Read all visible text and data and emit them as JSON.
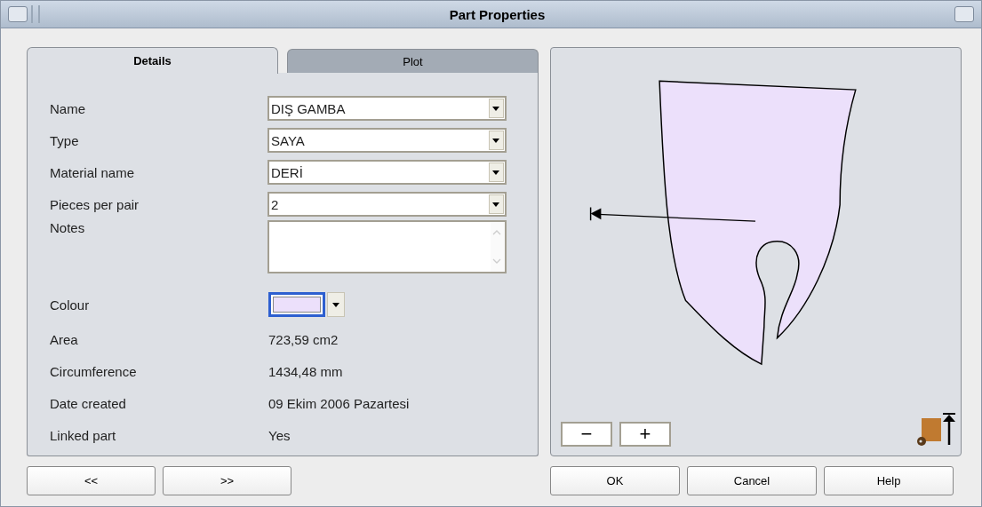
{
  "window": {
    "title": "Part Properties"
  },
  "tabs": [
    {
      "label": "Details",
      "selected": true
    },
    {
      "label": "Plot",
      "selected": false
    }
  ],
  "fields": [
    {
      "kind": "combo",
      "label": "Name",
      "value": "DIŞ GAMBA"
    },
    {
      "kind": "combo",
      "label": "Type",
      "value": "SAYA"
    },
    {
      "kind": "combo",
      "label": "Material name",
      "value": "DERİ"
    },
    {
      "kind": "combo",
      "label": "Pieces per pair",
      "value": "2"
    },
    {
      "kind": "memo",
      "label": "Notes"
    },
    {
      "kind": "colour",
      "label": "Colour",
      "color": "#ece0fb"
    },
    {
      "kind": "info",
      "label": "Area",
      "value": "723,59 cm2"
    },
    {
      "kind": "info",
      "label": "Circumference",
      "value": "1434,48 mm"
    },
    {
      "kind": "info",
      "label": "Date created",
      "value": "09 Ekim 2006 Pazartesi"
    },
    {
      "kind": "info",
      "label": "Linked part",
      "value": "Yes"
    }
  ],
  "preview": {
    "zoom_buttons": [
      "−",
      "+"
    ]
  },
  "nav_buttons": [
    "<<",
    ">>"
  ],
  "buttons": [
    "OK",
    "Cancel",
    "Help"
  ]
}
